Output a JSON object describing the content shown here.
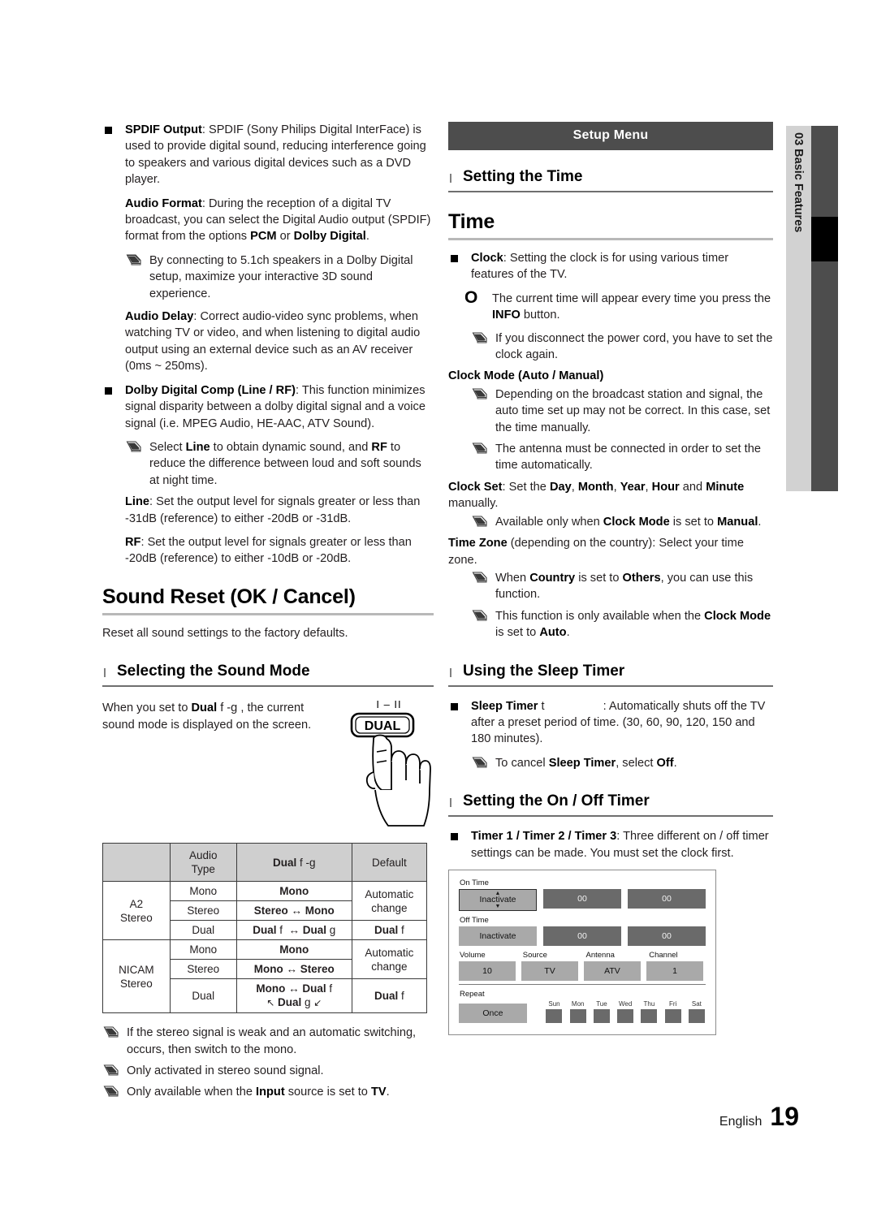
{
  "left_column": {
    "spdif": {
      "title": "SPDIF Output",
      "body": ": SPDIF (Sony Philips Digital InterFace) is used to provide digital sound, reducing interference going to speakers and various digital devices such as a DVD player."
    },
    "audio_format": {
      "title": "Audio Format",
      "body_1": ": During the reception of a digital TV broadcast, you can select the Digital Audio output (SPDIF) format from the options ",
      "opt_1": "PCM",
      "mid": " or ",
      "opt_2": "Dolby Digital",
      "end": ".",
      "note": "By connecting to 5.1ch speakers in a Dolby Digital setup, maximize your interactive 3D sound experience."
    },
    "audio_delay": {
      "title": "Audio Delay",
      "body": ": Correct audio-video sync problems, when watching TV or video, and when listening to digital audio output using an external device such as an AV receiver (0ms ~ 250ms)."
    },
    "dolby_comp": {
      "title": "Dolby Digital Comp (Line / RF)",
      "body": ": This function minimizes signal disparity between a dolby digital signal and a voice signal (i.e. MPEG Audio, HE-AAC, ATV Sound).",
      "note_pre": "Select ",
      "note_b1": "Line",
      "note_mid": " to obtain dynamic sound, and ",
      "note_b2": "RF",
      "note_end": " to reduce the difference between loud and soft sounds at night time.",
      "line_title": "Line",
      "line_body": ": Set the output level for signals greater or less than -31dB (reference) to either -20dB or -31dB.",
      "rf_title": "RF",
      "rf_body": ": Set the output level for signals greater or less than -20dB (reference) to either -10dB or -20dB."
    },
    "sound_reset": {
      "heading": "Sound Reset (OK / Cancel)",
      "body": "Reset all sound settings to the factory defaults."
    },
    "sound_mode": {
      "heading": "Selecting the Sound Mode",
      "text_pre": "When you set to ",
      "text_b": "Dual",
      "text_sym": " f -g ",
      "text_post": ", the current sound mode is displayed on the screen.",
      "button_top_label": "I – II",
      "button_label": "DUAL"
    },
    "audio_table": {
      "headers": [
        "",
        "Audio Type",
        "Dual f -g",
        "Default"
      ],
      "rows": [
        {
          "group": "A2 Stereo",
          "entries": [
            {
              "type": "Mono",
              "dual": "Mono",
              "default": "Automatic change"
            },
            {
              "type": "Stereo",
              "dual": "Stereo ↔ Mono",
              "default": ""
            },
            {
              "type": "Dual",
              "dual": "Dual f  ↔ Dual g",
              "default": "Dual f"
            }
          ]
        },
        {
          "group": "NICAM Stereo",
          "entries": [
            {
              "type": "Mono",
              "dual": "Mono",
              "default": "Automatic change"
            },
            {
              "type": "Stereo",
              "dual": "Mono ↔ Stereo",
              "default": ""
            },
            {
              "type": "Dual",
              "dual": "Mono ↔ Dual f",
              "dual_2": "↖ Dual g ↙",
              "default": "Dual f"
            }
          ]
        }
      ]
    },
    "table_notes": [
      "If the stereo signal is weak and an automatic switching, occurs, then switch to the mono.",
      "Only activated in stereo sound signal.",
      "Only available when the Input source is set to TV."
    ],
    "table_note_3": {
      "pre": "Only available when the ",
      "b1": "Input",
      "mid": " source is set to ",
      "b2": "TV",
      "end": "."
    }
  },
  "right_column": {
    "banner": "Setup Menu",
    "setting_time_heading": "Setting the Time",
    "time_heading": "Time",
    "clock": {
      "title": "Clock",
      "body": ": Setting the clock is for using various timer features of the TV.",
      "onote_pre": "The current time will appear every time you press the ",
      "onote_b": "INFO",
      "onote_end": " button.",
      "note": "If you disconnect the power cord, you have to set the clock again."
    },
    "clock_mode": {
      "title": "Clock Mode (Auto / Manual)",
      "note_1": "Depending on the broadcast station and signal, the auto time set up may not be correct. In this case, set the time manually.",
      "note_2": "The antenna must be connected in order to set the time automatically."
    },
    "clock_set": {
      "title": "Clock Set",
      "pre": ": Set the ",
      "b_day": "Day",
      "s1": ", ",
      "b_month": "Month",
      "s2": ", ",
      "b_year": "Year",
      "s3": ", ",
      "b_hour": "Hour",
      "s4": " and ",
      "b_minute": "Minute",
      "end": " manually.",
      "note_pre": "Available only when ",
      "note_b1": "Clock Mode",
      "note_mid": " is set to ",
      "note_b2": "Manual",
      "note_end": "."
    },
    "time_zone": {
      "title": "Time Zone",
      "body": " (depending on the country): Select your time zone.",
      "note_1_pre": "When ",
      "note_1_b1": "Country",
      "note_1_mid": " is set to ",
      "note_1_b2": "Others",
      "note_1_end": ", you can use this function.",
      "note_2_pre": "This function is only available when the ",
      "note_2_b1": "Clock Mode",
      "note_2_mid": " is set to ",
      "note_2_b2": "Auto",
      "note_2_end": "."
    },
    "sleep_timer": {
      "heading": "Using the Sleep Timer",
      "title": "Sleep Timer",
      "symbol": "t",
      "body": ": Automatically shuts off the TV after a preset period of time. (30, 60, 90, 120, 150 and 180 minutes).",
      "note_pre": "To cancel ",
      "note_b1": "Sleep Timer",
      "note_mid": ", select ",
      "note_b2": "Off",
      "note_end": "."
    },
    "on_off_timer": {
      "heading": "Setting the On / Off Timer",
      "title": "Timer 1 / Timer 2 / Timer 3",
      "body": ": Three different on / off timer settings can be made. You must set the clock first."
    },
    "osd": {
      "on_time_label": "On Time",
      "on_time_state": "Inactivate",
      "on_time_hour": "00",
      "on_time_min": "00",
      "off_time_label": "Off Time",
      "off_time_state": "Inactivate",
      "off_time_hour": "00",
      "off_time_min": "00",
      "volume_label": "Volume",
      "volume_value": "10",
      "source_label": "Source",
      "source_value": "TV",
      "antenna_label": "Antenna",
      "antenna_value": "ATV",
      "channel_label": "Channel",
      "channel_value": "1",
      "repeat_label": "Repeat",
      "repeat_value": "Once",
      "days": [
        "Sun",
        "Mon",
        "Tue",
        "Wed",
        "Thu",
        "Fri",
        "Sat"
      ]
    }
  },
  "side_tab": {
    "number": "03",
    "label": "Basic Features",
    "combined": "03   Basic Features"
  },
  "footer": {
    "language": "English",
    "page_number": "19"
  },
  "colors": {
    "banner_bg": "#4d4d4d",
    "sidebar_dark": "#4d4d4d",
    "sidebar_light": "#d2d2d2",
    "table_header": "#cfcfcf",
    "osd_light": "#a9a9a9",
    "osd_dark": "#6a6a6a"
  }
}
